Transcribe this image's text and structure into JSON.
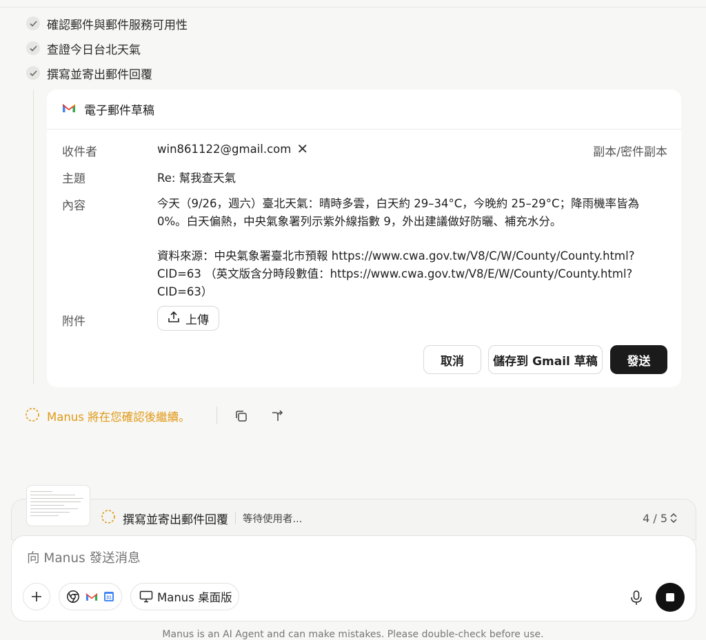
{
  "checklist": [
    {
      "label": "確認郵件與郵件服務可用性"
    },
    {
      "label": "查證今日台北天氣"
    },
    {
      "label": "撰寫並寄出郵件回覆"
    }
  ],
  "email": {
    "header": "電子郵件草稿",
    "to_label": "收件者",
    "to_value": "win861122@gmail.com",
    "cc_link": "副本/密件副本",
    "subject_label": "主題",
    "subject_value": "Re: 幫我查天氣",
    "body_label": "內容",
    "body_p1": "今天（9/26，週六）臺北天氣：晴時多雲，白天約 29–34°C，今晚約 25–29°C；降雨機率皆為 0%。白天偏熱，中央氣象署列示紫外線指數 9，外出建議做好防曬、補充水分。",
    "body_p2": "資料來源：中央氣象署臺北市預報 https://www.cwa.gov.tw/V8/C/W/County/County.html?CID=63 （英文版含分時段數值：https://www.cwa.gov.tw/V8/E/W/County/County.html?CID=63）",
    "attachment_label": "附件",
    "upload_label": "上傳",
    "cancel_label": "取消",
    "save_draft_label": "儲存到 Gmail 草稿",
    "send_label": "發送"
  },
  "status": {
    "text": "Manus 將在您確認後繼續。"
  },
  "task": {
    "title": "撰寫並寄出郵件回覆",
    "state": "等待使用者...",
    "progress": "4 / 5"
  },
  "composer": {
    "placeholder": "向 Manus 發送消息",
    "desktop_label": "Manus 桌面版",
    "calendar_day": "31"
  },
  "disclaimer": "Manus is an AI Agent and can make mistakes. Please double-check before use.",
  "colors": {
    "accent_orange": "#e09a18",
    "send_button": "#1b1b1b",
    "background": "#f7f7f5"
  }
}
